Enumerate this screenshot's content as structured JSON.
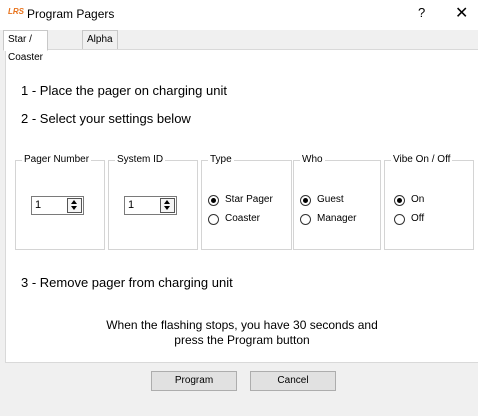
{
  "window": {
    "logo_text": "LRS",
    "title": "Program Pagers",
    "help_label": "?",
    "close_label": "✕"
  },
  "tabs": [
    {
      "label": "Star / Coaster",
      "active": true
    },
    {
      "label": "Alpha",
      "active": false
    }
  ],
  "steps": {
    "step1": "1 - Place the pager on charging unit",
    "step2": "2 - Select your settings below",
    "step3": "3 - Remove pager from charging unit"
  },
  "settings": {
    "pager_number": {
      "label": "Pager Number",
      "value": "1"
    },
    "system_id": {
      "label": "System ID",
      "value": "1"
    },
    "type": {
      "label": "Type",
      "options": [
        "Star Pager",
        "Coaster"
      ],
      "selected": "Star Pager"
    },
    "who": {
      "label": "Who",
      "options": [
        "Guest",
        "Manager"
      ],
      "selected": "Guest"
    },
    "vibe": {
      "label": "Vibe On / Off",
      "options": [
        "On",
        "Off"
      ],
      "selected": "On"
    }
  },
  "note": {
    "line1": "When the flashing stops, you have 30 seconds and",
    "line2": "press the Program button"
  },
  "buttons": {
    "program": "Program",
    "cancel": "Cancel"
  }
}
